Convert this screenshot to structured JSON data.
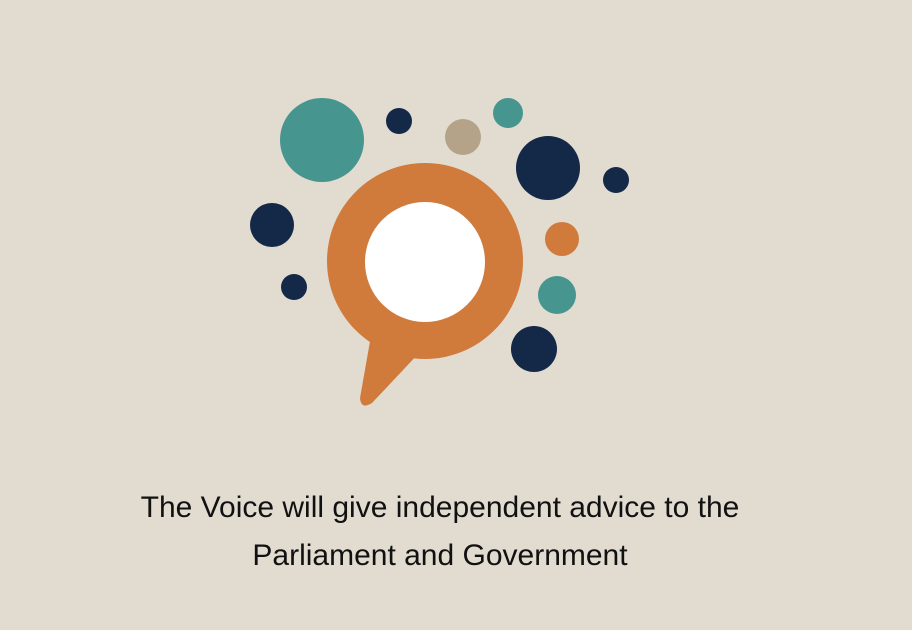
{
  "caption": {
    "line1": "The Voice will give independent advice to the",
    "line2": "Parliament and Government"
  },
  "logo": {
    "icon": "speech-bubble-with-dots-icon",
    "colors": {
      "orange": "#d07b3c",
      "teal": "#46958f",
      "navy": "#142847",
      "tan": "#b5a389",
      "white": "#ffffff",
      "background": "#e1dbd0"
    }
  }
}
